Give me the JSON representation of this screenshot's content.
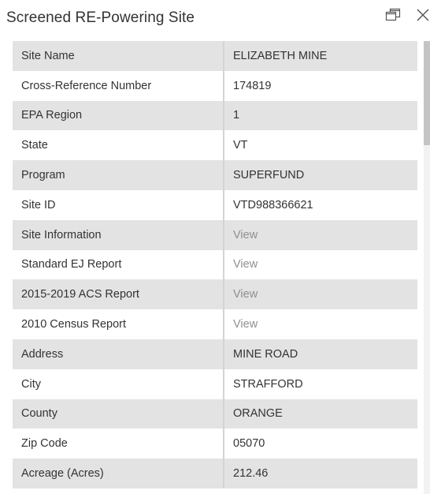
{
  "panel": {
    "title": "Screened RE-Powering Site",
    "rows": [
      {
        "label": "Site Name",
        "value": "ELIZABETH MINE",
        "is_link": false
      },
      {
        "label": "Cross-Reference Number",
        "value": "174819",
        "is_link": false
      },
      {
        "label": "EPA Region",
        "value": "1",
        "is_link": false
      },
      {
        "label": "State",
        "value": "VT",
        "is_link": false
      },
      {
        "label": "Program",
        "value": "SUPERFUND",
        "is_link": false
      },
      {
        "label": "Site ID",
        "value": "VTD988366621",
        "is_link": false
      },
      {
        "label": "Site Information",
        "value": "View",
        "is_link": true
      },
      {
        "label": "Standard EJ Report",
        "value": "View",
        "is_link": true
      },
      {
        "label": "2015-2019 ACS Report",
        "value": "View",
        "is_link": true
      },
      {
        "label": "2010 Census Report",
        "value": "View",
        "is_link": true
      },
      {
        "label": "Address",
        "value": "MINE ROAD",
        "is_link": false
      },
      {
        "label": "City",
        "value": "STRAFFORD",
        "is_link": false
      },
      {
        "label": "County",
        "value": "ORANGE",
        "is_link": false
      },
      {
        "label": "Zip Code",
        "value": "05070",
        "is_link": false
      },
      {
        "label": "Acreage (Acres)",
        "value": "212.46",
        "is_link": false
      }
    ]
  },
  "icons": {
    "dock": "dock-icon",
    "close": "close-icon"
  }
}
